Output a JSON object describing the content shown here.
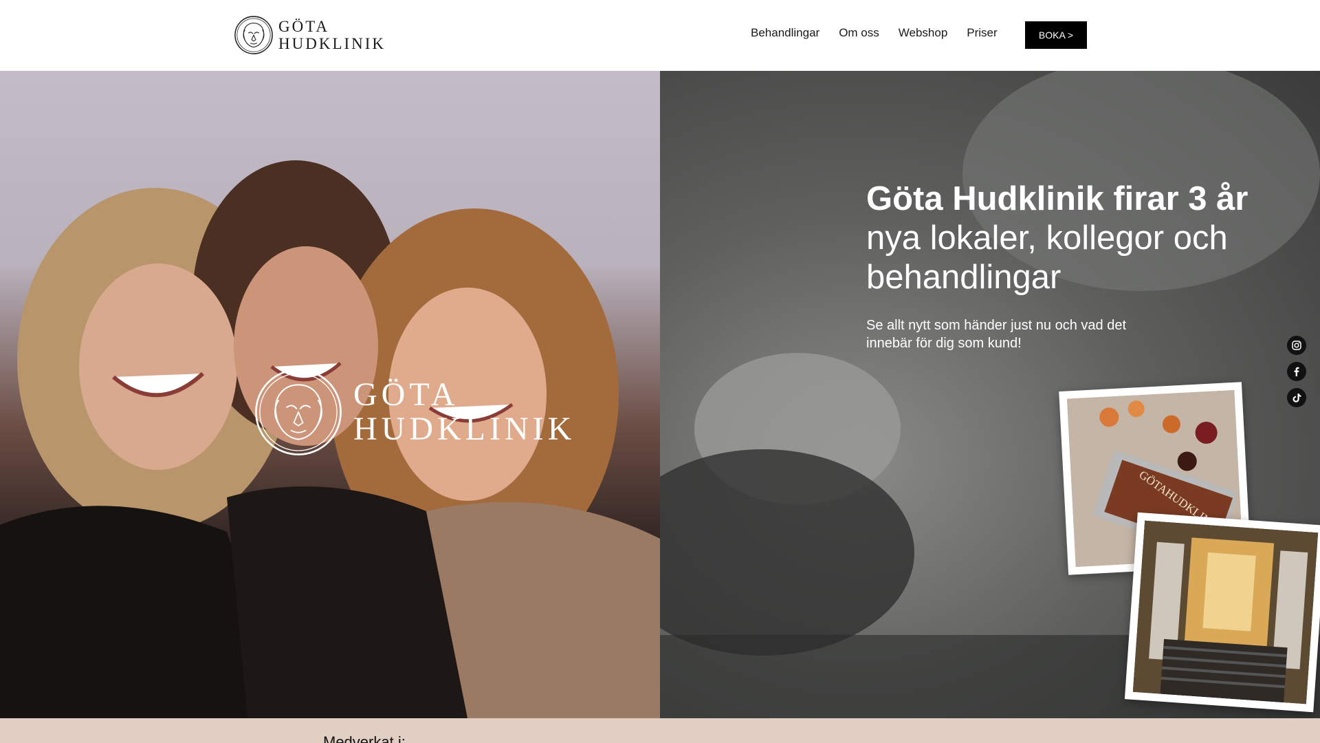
{
  "brand": {
    "logo_line1": "GÖTA",
    "logo_line2": "HUDKLINIK",
    "logo_icon": "lion-crest-icon"
  },
  "nav": {
    "items": [
      {
        "label": "Behandlingar"
      },
      {
        "label": "Om oss"
      },
      {
        "label": "Webshop"
      },
      {
        "label": "Priser"
      }
    ],
    "book_label": "BOKA >"
  },
  "hero": {
    "overlay_logo_line1": "GÖTA",
    "overlay_logo_line2": "HUDKLINIK",
    "title_strong": "Göta Hudklinik firar 3 år",
    "title_line2": "nya lokaler, kollegor och",
    "title_line3": "behandlingar",
    "subtitle_line1": "Se allt nytt som händer just nu och vad det",
    "subtitle_line2": "innebär för dig som kund!",
    "photo_cake_text": "GÖTAHUDKLINIK"
  },
  "social": [
    {
      "icon": "instagram-icon"
    },
    {
      "icon": "facebook-icon"
    },
    {
      "icon": "tiktok-icon"
    }
  ],
  "band": {
    "text": "Medverkat i:"
  },
  "colors": {
    "button_bg": "#000000",
    "band_bg": "#e2cfc4",
    "header_bg": "#ffffff"
  }
}
